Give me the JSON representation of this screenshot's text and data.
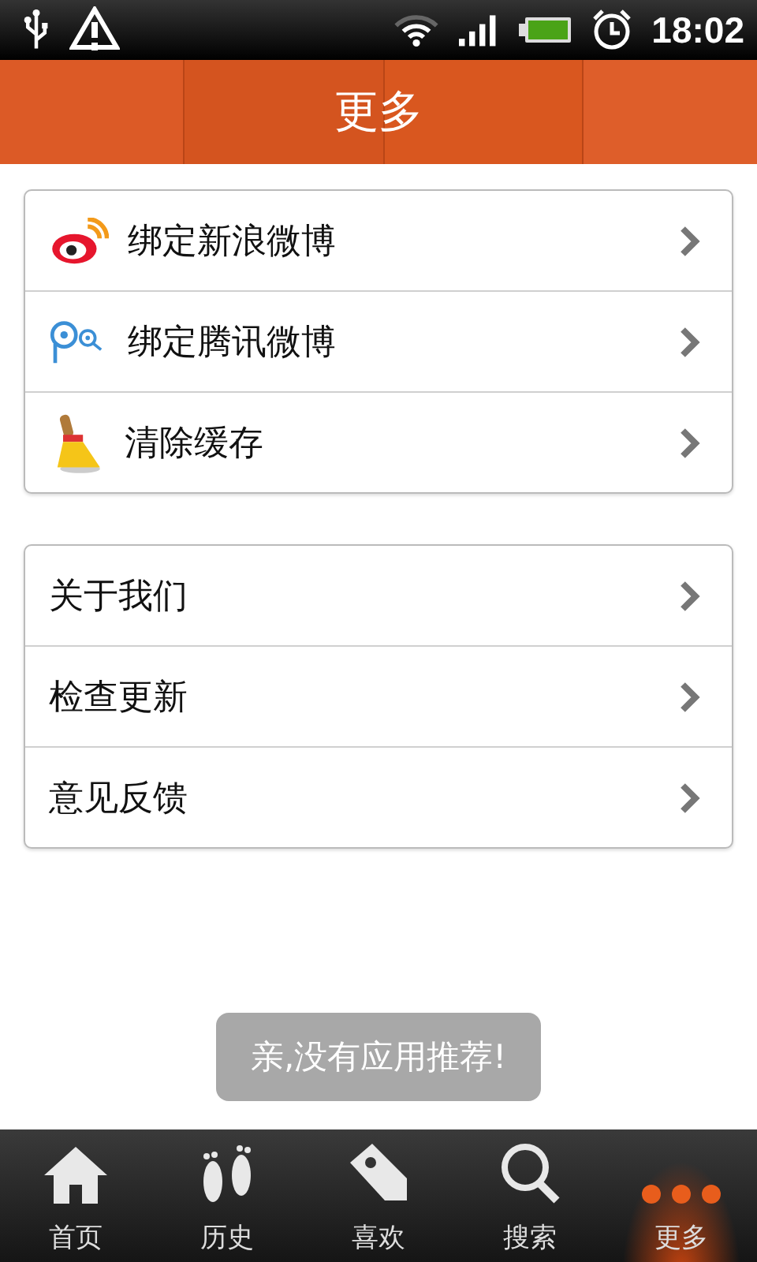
{
  "status_bar": {
    "time": "18:02"
  },
  "header": {
    "title": "更多"
  },
  "groups": [
    {
      "items": [
        {
          "label": "绑定新浪微博",
          "kind": "weibo"
        },
        {
          "label": "绑定腾讯微博",
          "kind": "tencent"
        },
        {
          "label": "清除缓存",
          "kind": "broom"
        }
      ]
    },
    {
      "items": [
        {
          "label": "关于我们"
        },
        {
          "label": "检查更新"
        },
        {
          "label": "意见反馈"
        }
      ]
    }
  ],
  "toast": {
    "text": "亲,没有应用推荐!"
  },
  "tabs": [
    {
      "label": "首页",
      "kind": "home",
      "selected": false
    },
    {
      "label": "历史",
      "kind": "feet",
      "selected": false
    },
    {
      "label": "喜欢",
      "kind": "tag",
      "selected": false
    },
    {
      "label": "搜索",
      "kind": "search",
      "selected": false
    },
    {
      "label": "更多",
      "kind": "dots",
      "selected": true
    }
  ]
}
